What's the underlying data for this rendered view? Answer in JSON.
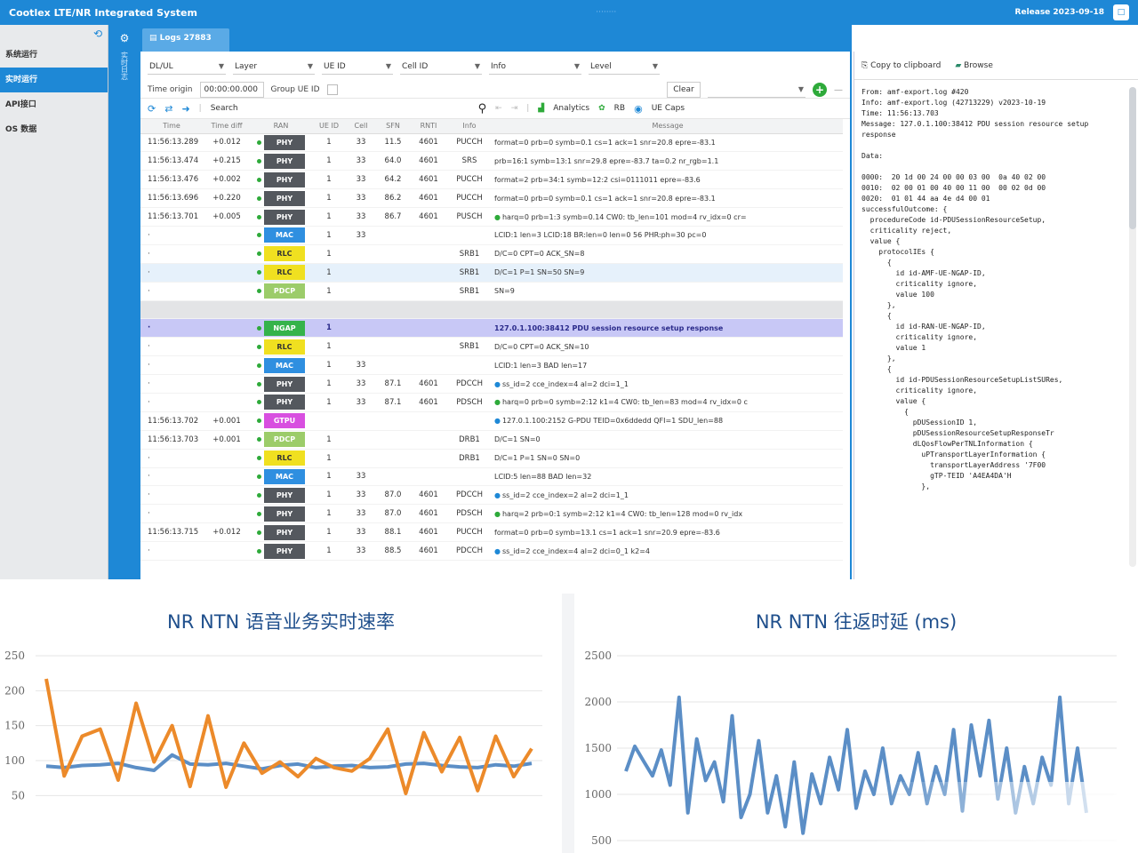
{
  "window": {
    "title": "Cootlex LTE/NR Integrated System",
    "center_label": "········",
    "release": "Release 2023-09-18",
    "win_btn": "□"
  },
  "sidebar": {
    "items": [
      {
        "label": "系统运行"
      },
      {
        "label": "实时运行"
      },
      {
        "label": "API接口"
      },
      {
        "label": "OS 数据"
      }
    ]
  },
  "strip": {
    "text": "实时日志"
  },
  "tab": {
    "label": "Logs  27883"
  },
  "filters": {
    "row1": [
      {
        "label": "DL/UL",
        "width": 88
      },
      {
        "label": "Layer",
        "width": 92
      },
      {
        "label": "UE ID",
        "width": 80
      },
      {
        "label": "Cell ID",
        "width": 92
      },
      {
        "label": "Info",
        "width": 104
      },
      {
        "label": "Level",
        "width": 80
      }
    ],
    "time_origin_label": "Time origin",
    "time_origin_value": "00:00:00.000",
    "group_label": "Group UE ID",
    "clear_label": "Clear",
    "plus": "+"
  },
  "toolbar": {
    "search": "Search",
    "analytics": "Analytics",
    "rb": "RB",
    "ue_caps": "UE Caps"
  },
  "columns": [
    "Time",
    "Time diff",
    "RAN",
    "UE ID",
    "Cell",
    "SFN",
    "RNTI",
    "Info",
    "Message"
  ],
  "rows": [
    {
      "time": "11:56:13.289",
      "diff": "+0.012",
      "layer": "PHY",
      "layer_color": "#54585e",
      "ue": "1",
      "cell": "33",
      "sfn": "11.5",
      "rnti": "4601",
      "info": "PUCCH",
      "icon": "",
      "msg": "format=0 prb=0 symb=0.1 cs=1 ack=1 snr=20.8 epre=-83.1",
      "style": ""
    },
    {
      "time": "11:56:13.474",
      "diff": "+0.215",
      "layer": "PHY",
      "layer_color": "#54585e",
      "ue": "1",
      "cell": "33",
      "sfn": "64.0",
      "rnti": "4601",
      "info": "SRS",
      "icon": "",
      "msg": "prb=16:1 symb=13:1 snr=29.8 epre=-83.7 ta=0.2 nr_rgb=1.1",
      "style": ""
    },
    {
      "time": "11:56:13.476",
      "diff": "+0.002",
      "layer": "PHY",
      "layer_color": "#54585e",
      "ue": "1",
      "cell": "33",
      "sfn": "64.2",
      "rnti": "4601",
      "info": "PUCCH",
      "icon": "",
      "msg": "format=2 prb=34:1 symb=12:2 csi=0111011 epre=-83.6",
      "style": ""
    },
    {
      "time": "11:56:13.696",
      "diff": "+0.220",
      "layer": "PHY",
      "layer_color": "#54585e",
      "ue": "1",
      "cell": "33",
      "sfn": "86.2",
      "rnti": "4601",
      "info": "PUCCH",
      "icon": "",
      "msg": "format=0 prb=0 symb=0.1 cs=1 ack=1 snr=20.8 epre=-83.1",
      "style": ""
    },
    {
      "time": "11:56:13.701",
      "diff": "+0.005",
      "layer": "PHY",
      "layer_color": "#54585e",
      "ue": "1",
      "cell": "33",
      "sfn": "86.7",
      "rnti": "4601",
      "info": "PUSCH",
      "icon": "green",
      "msg": "harq=0 prb=1:3 symb=0.14 CW0: tb_len=101 mod=4 rv_idx=0 cr=",
      "style": ""
    },
    {
      "time": "·",
      "diff": "",
      "layer": "MAC",
      "layer_color": "#2f8fe0",
      "ue": "1",
      "cell": "33",
      "sfn": "",
      "rnti": "",
      "info": "",
      "icon": "",
      "msg": "LCID:1 len=3 LCID:18 BR:len=0 len=0 56 PHR:ph=30 pc=0",
      "style": ""
    },
    {
      "time": "·",
      "diff": "",
      "layer": "RLC",
      "layer_color": "#f0e020",
      "ue": "1",
      "cell": "",
      "sfn": "",
      "rnti": "",
      "info": "SRB1",
      "icon": "",
      "msg": "D/C=0 CPT=0 ACK_SN=8",
      "style": ""
    },
    {
      "time": "·",
      "diff": "",
      "layer": "RLC",
      "layer_color": "#f0e020",
      "ue": "1",
      "cell": "",
      "sfn": "",
      "rnti": "",
      "info": "SRB1",
      "icon": "",
      "msg": "D/C=1 P=1 SN=50 SN=9",
      "style": "sel-blue"
    },
    {
      "time": "·",
      "diff": "",
      "layer": "PDCP",
      "layer_color": "#9ccc6a",
      "ue": "1",
      "cell": "",
      "sfn": "",
      "rnti": "",
      "info": "SRB1",
      "icon": "",
      "msg": "SN=9",
      "style": ""
    },
    {
      "time": "",
      "diff": "",
      "layer": "",
      "layer_color": "",
      "ue": "",
      "cell": "",
      "sfn": "",
      "rnti": "",
      "info": "",
      "icon": "",
      "msg": "",
      "style": "sep-row"
    },
    {
      "time": "·",
      "diff": "",
      "layer": "NGAP",
      "layer_color": "#35b34a",
      "ue": "1",
      "cell": "",
      "sfn": "",
      "rnti": "",
      "info": "",
      "icon": "",
      "msg": "127.0.1.100:38412 PDU session resource setup response",
      "style": "sel-purple"
    },
    {
      "time": "·",
      "diff": "",
      "layer": "RLC",
      "layer_color": "#f0e020",
      "ue": "1",
      "cell": "",
      "sfn": "",
      "rnti": "",
      "info": "SRB1",
      "icon": "",
      "msg": "D/C=0 CPT=0 ACK_SN=10",
      "style": ""
    },
    {
      "time": "·",
      "diff": "",
      "layer": "MAC",
      "layer_color": "#2f8fe0",
      "ue": "1",
      "cell": "33",
      "sfn": "",
      "rnti": "",
      "info": "",
      "icon": "",
      "msg": "LCID:1 len=3 BAD len=17",
      "style": ""
    },
    {
      "time": "·",
      "diff": "",
      "layer": "PHY",
      "layer_color": "#54585e",
      "ue": "1",
      "cell": "33",
      "sfn": "87.1",
      "rnti": "4601",
      "info": "PDCCH",
      "icon": "blue",
      "msg": "ss_id=2 cce_index=4 al=2 dci=1_1",
      "style": ""
    },
    {
      "time": "·",
      "diff": "",
      "layer": "PHY",
      "layer_color": "#54585e",
      "ue": "1",
      "cell": "33",
      "sfn": "87.1",
      "rnti": "4601",
      "info": "PDSCH",
      "icon": "green",
      "msg": "harq=0 prb=0 symb=2:12 k1=4 CW0: tb_len=83 mod=4 rv_idx=0 c",
      "style": ""
    },
    {
      "time": "11:56:13.702",
      "diff": "+0.001",
      "layer": "GTPU",
      "layer_color": "#d84fe0",
      "ue": "",
      "cell": "",
      "sfn": "",
      "rnti": "",
      "info": "",
      "icon": "blue",
      "msg": "127.0.1.100:2152 G-PDU TEID=0x6ddedd QFI=1 SDU_len=88",
      "style": ""
    },
    {
      "time": "11:56:13.703",
      "diff": "+0.001",
      "layer": "PDCP",
      "layer_color": "#9ccc6a",
      "ue": "1",
      "cell": "",
      "sfn": "",
      "rnti": "",
      "info": "DRB1",
      "icon": "",
      "msg": "D/C=1 SN=0",
      "style": ""
    },
    {
      "time": "·",
      "diff": "",
      "layer": "RLC",
      "layer_color": "#f0e020",
      "ue": "1",
      "cell": "",
      "sfn": "",
      "rnti": "",
      "info": "DRB1",
      "icon": "",
      "msg": "D/C=1 P=1 SN=0 SN=0",
      "style": ""
    },
    {
      "time": "·",
      "diff": "",
      "layer": "MAC",
      "layer_color": "#2f8fe0",
      "ue": "1",
      "cell": "33",
      "sfn": "",
      "rnti": "",
      "info": "",
      "icon": "",
      "msg": "LCID:5 len=88 BAD len=32",
      "style": ""
    },
    {
      "time": "·",
      "diff": "",
      "layer": "PHY",
      "layer_color": "#54585e",
      "ue": "1",
      "cell": "33",
      "sfn": "87.0",
      "rnti": "4601",
      "info": "PDCCH",
      "icon": "blue",
      "msg": "ss_id=2 cce_index=2 al=2 dci=1_1",
      "style": ""
    },
    {
      "time": "·",
      "diff": "",
      "layer": "PHY",
      "layer_color": "#54585e",
      "ue": "1",
      "cell": "33",
      "sfn": "87.0",
      "rnti": "4601",
      "info": "PDSCH",
      "icon": "green",
      "msg": "harq=2 prb=0:1 symb=2:12 k1=4 CW0: tb_len=128 mod=0 rv_idx",
      "style": ""
    },
    {
      "time": "11:56:13.715",
      "diff": "+0.012",
      "layer": "PHY",
      "layer_color": "#54585e",
      "ue": "1",
      "cell": "33",
      "sfn": "88.1",
      "rnti": "4601",
      "info": "PUCCH",
      "icon": "",
      "msg": "format=0 prb=0 symb=13.1 cs=1 ack=1 snr=20.9 epre=-83.6",
      "style": ""
    },
    {
      "time": "·",
      "diff": "",
      "layer": "PHY",
      "layer_color": "#54585e",
      "ue": "1",
      "cell": "33",
      "sfn": "88.5",
      "rnti": "4601",
      "info": "PDCCH",
      "icon": "blue",
      "msg": "ss_id=2 cce_index=4 al=2 dci=0_1 k2=4",
      "style": ""
    }
  ],
  "detail": {
    "copy_label": "Copy to clipboard",
    "browse_label": "Browse",
    "body": "From: amf-export.log #420\nInfo: amf-export.log (42713229) v2023-10-19\nTime: 11:56:13.703\nMessage: 127.0.1.100:38412 PDU session resource setup\nresponse\n\nData:\n\n0000:  20 1d 00 24 00 00 03 00  0a 40 02 00\n0010:  02 00 01 00 40 00 11 00  00 02 0d 00\n0020:  01 01 44 aa 4e d4 00 01\nsuccessfulOutcome: {\n  procedureCode id-PDUSessionResourceSetup,\n  criticality reject,\n  value {\n    protocolIEs {\n      {\n        id id-AMF-UE-NGAP-ID,\n        criticality ignore,\n        value 100\n      },\n      {\n        id id-RAN-UE-NGAP-ID,\n        criticality ignore,\n        value 1\n      },\n      {\n        id id-PDUSessionResourceSetupListSURes,\n        criticality ignore,\n        value {\n          {\n            pDUSessionID 1,\n            pDUSessionResourceSetupResponseTr\n            dLQosFlowPerTNLInformation {\n              uPTransportLayerInformation {\n                transportLayerAddress '7F00\n                gTP-TEID 'A4EA4DA'H\n              },"
  },
  "chart_data": [
    {
      "type": "line",
      "title": "NR NTN 语音业务实时速率",
      "xlabel": "",
      "ylabel": "",
      "ylim": [
        25,
        250
      ],
      "yticks": [
        50,
        100,
        150,
        200,
        250
      ],
      "series": [
        {
          "color": "#ec8a2a",
          "values": [
            217,
            78,
            135,
            145,
            72,
            182,
            98,
            150,
            63,
            164,
            62,
            125,
            82,
            98,
            77,
            103,
            90,
            85,
            103,
            145,
            53,
            140,
            84,
            133,
            57,
            135,
            77,
            117
          ]
        },
        {
          "color": "#5b8ec6",
          "values": [
            92,
            90,
            93,
            94,
            96,
            90,
            86,
            108,
            95,
            94,
            96,
            92,
            88,
            93,
            95,
            90,
            92,
            93,
            90,
            91,
            95,
            96,
            93,
            91,
            90,
            94,
            92,
            96
          ]
        }
      ]
    },
    {
      "type": "line",
      "title": "NR NTN 往返时延 (ms)",
      "xlabel": "",
      "ylabel": "",
      "ylim": [
        500,
        2500
      ],
      "yticks": [
        500,
        1000,
        1500,
        2000,
        2500
      ],
      "series": [
        {
          "color": "#5b8ec6",
          "values": [
            1250,
            1520,
            1360,
            1200,
            1480,
            1100,
            2050,
            800,
            1600,
            1150,
            1350,
            920,
            1850,
            750,
            1000,
            1580,
            800,
            1200,
            650,
            1350,
            580,
            1220,
            900,
            1400,
            1050,
            1700,
            850,
            1250,
            1000,
            1500,
            900,
            1200,
            1000,
            1450,
            900,
            1300,
            1000,
            1700,
            820,
            1750,
            1200,
            1800,
            950,
            1500,
            800,
            1300,
            900,
            1400,
            1100,
            2050,
            900,
            1500,
            800
          ]
        }
      ]
    }
  ]
}
